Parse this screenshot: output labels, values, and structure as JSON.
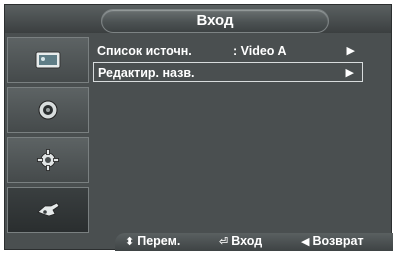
{
  "title": "Вход",
  "sidebar": {
    "items": [
      {
        "icon": "picture-icon"
      },
      {
        "icon": "sound-icon"
      },
      {
        "icon": "gear-icon"
      },
      {
        "icon": "input-plug-icon",
        "active": true
      }
    ]
  },
  "menu": {
    "items": [
      {
        "label": "Список источн.",
        "value": ": Video A",
        "arrow": "▶"
      },
      {
        "label": "Редактир. назв.",
        "value": "",
        "arrow": "▶",
        "selected": true
      }
    ]
  },
  "footer": {
    "move_symbol": "⬍",
    "move_label": "Перем.",
    "enter_symbol": "⏎",
    "enter_label": "Вход",
    "back_symbol": "◀",
    "back_label": "Возврат"
  }
}
